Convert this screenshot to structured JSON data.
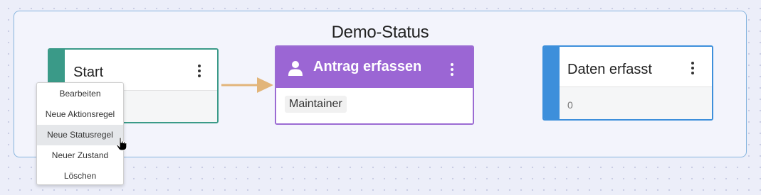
{
  "group": {
    "title": "Demo-Status"
  },
  "nodes": {
    "start": {
      "title": "Start",
      "color": "#3a9a88"
    },
    "action": {
      "title": "Antrag erfassen",
      "role": "Maintainer",
      "color": "#9b66d4",
      "icon": "person-icon"
    },
    "result": {
      "title": "Daten erfasst",
      "count": "0",
      "color": "#3d8fdb"
    }
  },
  "connector": {
    "color": "#e2b57a"
  },
  "context_menu": {
    "items": [
      {
        "label": "Bearbeiten"
      },
      {
        "label": "Neue Aktionsregel"
      },
      {
        "label": "Neue Statusregel",
        "hovered": true
      },
      {
        "label": "Neuer Zustand"
      },
      {
        "label": "Löschen"
      }
    ]
  }
}
